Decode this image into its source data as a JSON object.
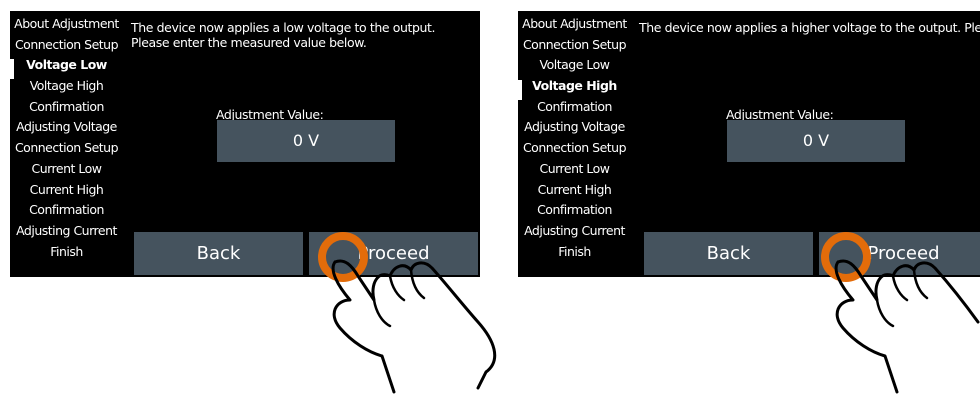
{
  "screens": [
    {
      "sidebar": {
        "items": [
          {
            "label": "About Adjustment",
            "active": false
          },
          {
            "label": "Connection Setup",
            "active": false
          },
          {
            "label": "Voltage Low",
            "active": true
          },
          {
            "label": "Voltage High",
            "active": false
          },
          {
            "label": "Confirmation",
            "active": false
          },
          {
            "label": "Adjusting Voltage",
            "active": false
          },
          {
            "label": "Connection Setup",
            "active": false
          },
          {
            "label": "Current Low",
            "active": false
          },
          {
            "label": "Current High",
            "active": false
          },
          {
            "label": "Confirmation",
            "active": false
          },
          {
            "label": "Adjusting Current",
            "active": false
          },
          {
            "label": "Finish",
            "active": false
          }
        ]
      },
      "message": "The device now applies a low voltage to the output. Please enter the measured value below.",
      "adjustment_label": "Adjustment Value:",
      "adjustment_value": "0 V",
      "back_label": "Back",
      "proceed_label": "Proceed"
    },
    {
      "sidebar": {
        "items": [
          {
            "label": "About Adjustment",
            "active": false
          },
          {
            "label": "Connection Setup",
            "active": false
          },
          {
            "label": "Voltage Low",
            "active": false
          },
          {
            "label": "Voltage High",
            "active": true
          },
          {
            "label": "Confirmation",
            "active": false
          },
          {
            "label": "Adjusting Voltage",
            "active": false
          },
          {
            "label": "Connection Setup",
            "active": false
          },
          {
            "label": "Current Low",
            "active": false
          },
          {
            "label": "Current High",
            "active": false
          },
          {
            "label": "Confirmation",
            "active": false
          },
          {
            "label": "Adjusting Current",
            "active": false
          },
          {
            "label": "Finish",
            "active": false
          }
        ]
      },
      "message": "The device now applies a higher voltage to the output. Please enter the measured value below.",
      "adjustment_label": "Adjustment Value:",
      "adjustment_value": "0 V",
      "back_label": "Back",
      "proceed_label": "Proceed"
    }
  ],
  "colors": {
    "screen_bg": "#000000",
    "button_bg": "#45535e",
    "text": "#ffffff",
    "touch_ring": "#e36c0a"
  }
}
